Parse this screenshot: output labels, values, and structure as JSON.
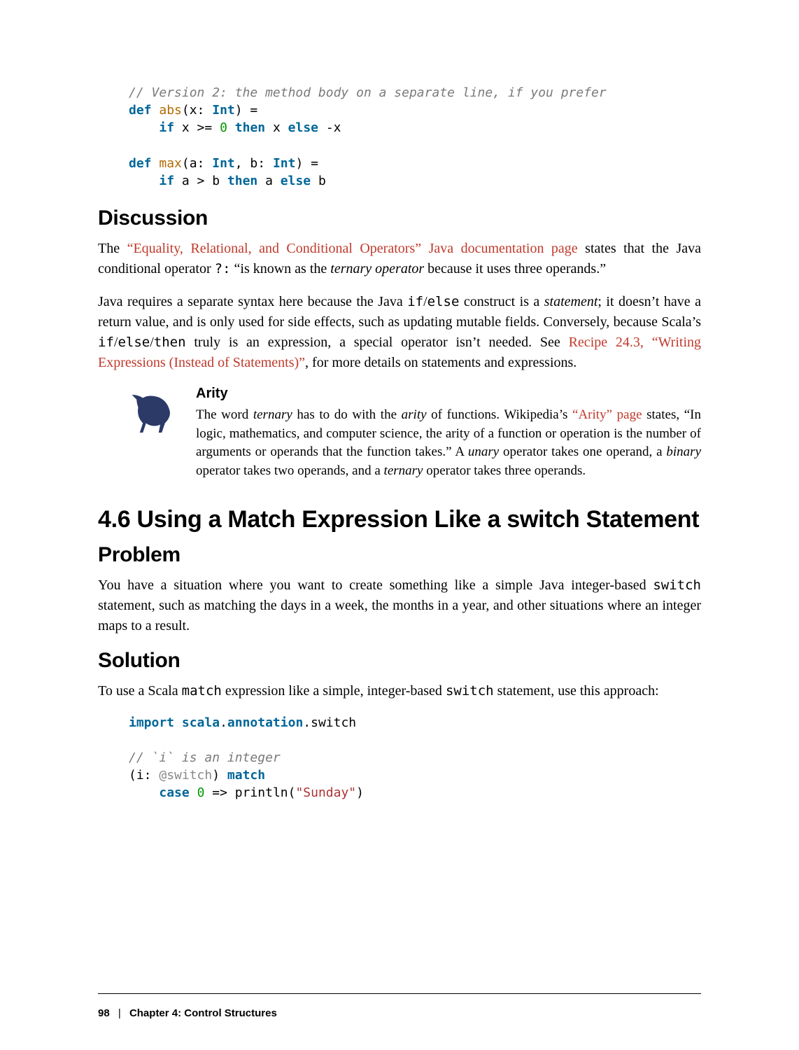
{
  "code1": {
    "comment": "// Version 2: the method body on a separate line, if you prefer",
    "def": "def",
    "abs": "abs",
    "sig1a": "(x: ",
    "Int": "Int",
    "sig1b": ") =",
    "if": "if",
    "expr_open": " x >= ",
    "zero": "0",
    "then": "then",
    "x": " x ",
    "else": "else",
    "negx": " -x"
  },
  "code2": {
    "def": "def",
    "max": "max",
    "sig_a": "(a: ",
    "Int": "Int",
    "comma": ", b: ",
    "sig_b": ") =",
    "if": "if",
    "cond": " a > b ",
    "then": "then",
    "a": " a ",
    "else": "else",
    "b": " b"
  },
  "discussion": {
    "heading": "Discussion",
    "p1_pre": "The ",
    "p1_link": "“Equality, Relational, and Conditional Operators” Java documentation page",
    "p1_post": " states that the Java conditional operator ",
    "p1_qm": "?:",
    "p1_after": " “is known as the ",
    "p1_em": "ternary operator",
    "p1_end": " because it uses three operands.”",
    "p2_a": "Java requires a separate syntax here because the Java ",
    "p2_if": "if",
    "p2_slash": "/",
    "p2_else": "else",
    "p2_b": " construct is a ",
    "p2_stmt": "statement",
    "p2_c": "; it doesn’t have a return value, and is only used for side effects, such as updating muta­ble fields. Conversely, because Scala’s ",
    "p2_if2": "if",
    "p2_else2": "else",
    "p2_then": "then",
    "p2_d": " truly is an expression, a special operator isn’t needed. See ",
    "p2_link": "Recipe 24.3, “Writing Expressions (Instead of Statements)”",
    "p2_e": ", for more details on statements and expressions."
  },
  "note": {
    "title": "Arity",
    "a": "The word ",
    "ternary": "ternary",
    "b": " has to do with the ",
    "arity": "arity",
    "c": " of functions. Wikipedia’s ",
    "link": "“Arity” page",
    "d": " states, “In logic, mathematics, and computer science, the arity of a function or operation is the number of arguments or operands that the function takes.” A ",
    "unary": "unary",
    "e": " operator takes one operand, a ",
    "binary": "binary",
    "f": " operator takes two operands, and a ",
    "ternary2": "ternary",
    "g": " oper­ator takes three operands."
  },
  "section": {
    "heading": "4.6 Using a Match Expression Like a switch Statement"
  },
  "problem": {
    "heading": "Problem",
    "a": "You have a situation where you want to create something like a simple Java integer-based ",
    "switch": "switch",
    "b": " statement, such as matching the days in a week, the months in a year, and other situations where an integer maps to a result."
  },
  "solution": {
    "heading": "Solution",
    "a": "To use a Scala ",
    "match": "match",
    "b": " expression like a simple, integer-based ",
    "switch": "switch",
    "c": " statement, use this approach:"
  },
  "code3": {
    "import": "import",
    "pkg1": "scala",
    "dot": ".",
    "pkg2": "annotation",
    "pkg3": "switch",
    "comment": "// `i` is an integer",
    "open": "(i: ",
    "ann": "@switch",
    "close": ") ",
    "match": "match",
    "case": "case",
    "zero": "0",
    "arrow": " => println(",
    "str": "\"Sunday\"",
    "end": ")"
  },
  "footer": {
    "page": "98",
    "sep": "|",
    "chapter": "Chapter 4: Control Structures"
  }
}
